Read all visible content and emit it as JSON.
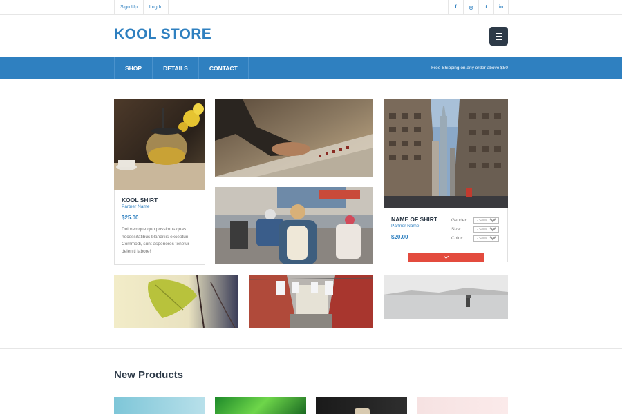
{
  "topbar": {
    "signup": "Sign Up",
    "login": "Log In",
    "social": [
      {
        "icon": "facebook-icon",
        "glyph": "f"
      },
      {
        "icon": "dribbble-icon",
        "glyph": "◎"
      },
      {
        "icon": "twitter-icon",
        "glyph": "t"
      },
      {
        "icon": "linkedin-icon",
        "glyph": "in"
      }
    ]
  },
  "header": {
    "logo": "KOOL STORE",
    "menu_icon": "hamburger-icon"
  },
  "nav": {
    "items": [
      "SHOP",
      "DETAILS",
      "CONTACT"
    ],
    "shipping": "Free Shipping on any order above $50"
  },
  "product1": {
    "title": "KOOL SHIRT",
    "partner": "Partner Name",
    "price": "$25.00",
    "description": "Doloremque quo possimus quas necessitatibus blanditiis excepturi. Commodi, sunt asperiores tenetur deleniti labore!"
  },
  "product2": {
    "title": "NAME OF SHIRT",
    "partner": "Partner Name",
    "price": "$20.00",
    "options": [
      {
        "label": "Gender:",
        "value": "- Select -"
      },
      {
        "label": "Size:",
        "value": "- Select -"
      },
      {
        "label": "Color:",
        "value": "- Select -"
      }
    ],
    "cart_icon": "chevron-down-icon"
  },
  "new_products": {
    "title": "New Products"
  },
  "colors": {
    "brand": "#2f80c0",
    "dark": "#2d3a48",
    "accent": "#e34b3e"
  }
}
